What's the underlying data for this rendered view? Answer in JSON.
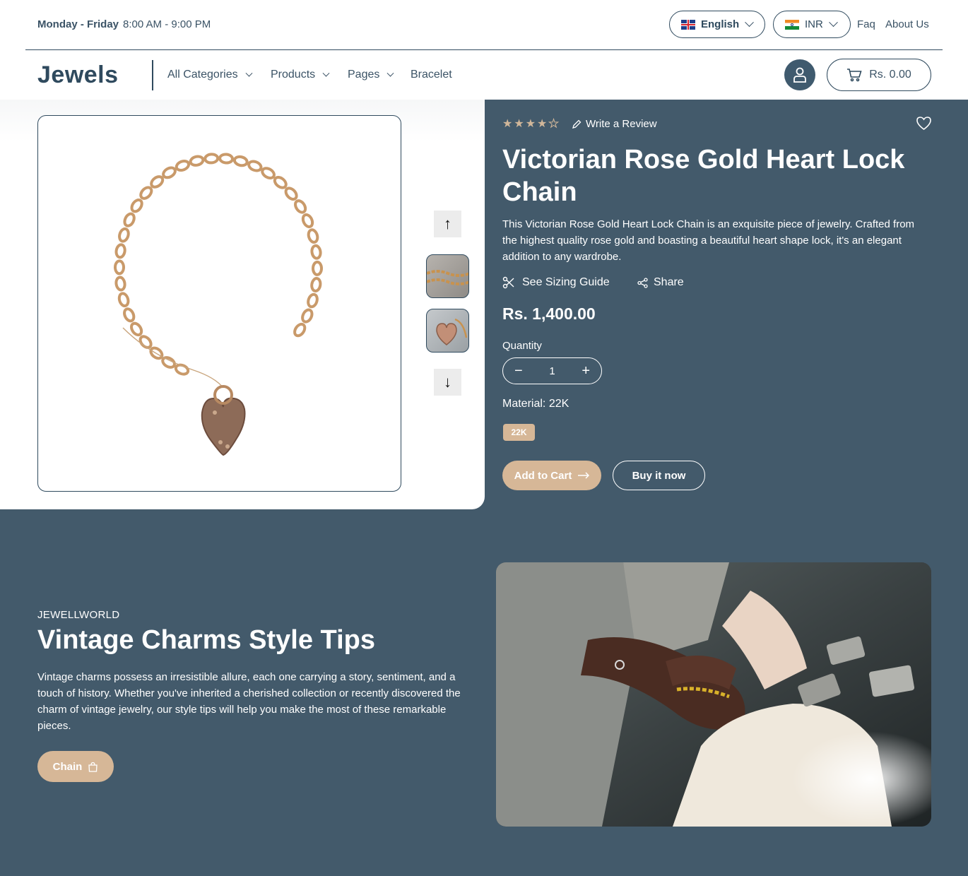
{
  "topbar": {
    "days": "Monday - Friday",
    "time": "8:00 AM - 9:00 PM",
    "language": "English",
    "currency": "INR",
    "faq": "Faq",
    "about": "About Us"
  },
  "nav": {
    "logo": "Jewels",
    "items": [
      "All Categories",
      "Products",
      "Pages",
      "Bracelet"
    ],
    "cart_total": "Rs. 0.00"
  },
  "product": {
    "rating": 4,
    "rating_max": 5,
    "write_review": "Write a Review",
    "title": "Victorian Rose Gold Heart Lock Chain",
    "description": "This Victorian Rose Gold Heart Lock Chain is an exquisite piece of jewelry. Crafted from the highest quality rose gold and boasting a beautiful heart shape lock, it's an elegant addition to any wardrobe.",
    "sizing_guide": "See Sizing Guide",
    "share": "Share",
    "price": "Rs. 1,400.00",
    "quantity_label": "Quantity",
    "quantity": "1",
    "material_label": "Material:",
    "material_value": "22K",
    "material_chip": "22K",
    "add_to_cart": "Add to Cart",
    "buy_now": "Buy it now"
  },
  "blog": {
    "kicker": "JEWELLWORLD",
    "title": "Vintage Charms Style Tips",
    "text": "Vintage charms possess an irresistible allure, each one carrying a story, sentiment, and a touch of history. Whether you've inherited a cherished collection or recently discovered the charm of vintage jewelry, our style tips will help you make the most of these remarkable pieces.",
    "button": "Chain"
  },
  "colors": {
    "primary": "#2f4a5e",
    "panel": "#435a6b",
    "accent": "#d6b797"
  }
}
